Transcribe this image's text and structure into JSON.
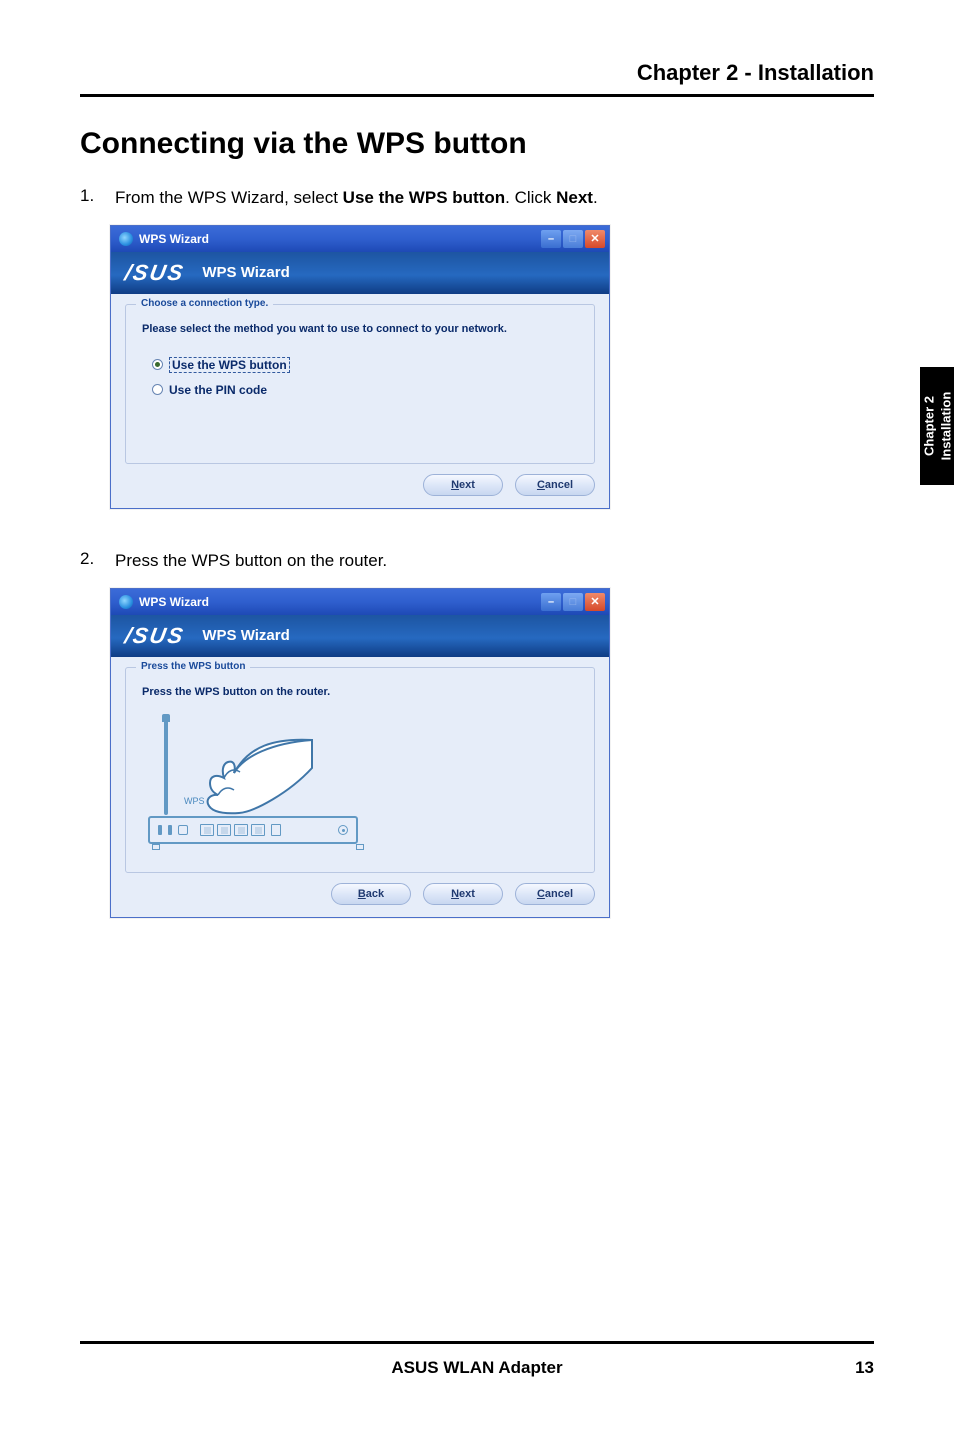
{
  "chapter_header": "Chapter 2 - Installation",
  "section_title": "Connecting via the WPS button",
  "side_tab": {
    "line1": "Chapter 2",
    "line2": "Installation"
  },
  "steps": [
    {
      "num": "1.",
      "prefix": "From the WPS Wizard, select ",
      "bold1": "Use the WPS button",
      "mid": ". Click ",
      "bold2": "Next",
      "suffix": "."
    },
    {
      "num": "2.",
      "text": "Press the WPS button on the router."
    }
  ],
  "wizard1": {
    "titlebar": "WPS Wizard",
    "banner_title": "WPS Wizard",
    "legend": "Choose a connection type.",
    "instruction": "Please select the method you want to use to connect to your network.",
    "option1": "Use the WPS button",
    "option2": "Use the PIN code",
    "btn_next": "Next",
    "btn_cancel": "Cancel"
  },
  "wizard2": {
    "titlebar": "WPS Wizard",
    "banner_title": "WPS Wizard",
    "legend": "Press the WPS button",
    "instruction": "Press the WPS button on the router.",
    "wps_label": "WPS",
    "btn_back": "Back",
    "btn_next": "Next",
    "btn_cancel": "Cancel"
  },
  "footer": {
    "center": "ASUS WLAN Adapter",
    "page": "13"
  },
  "logo": "/SUS"
}
